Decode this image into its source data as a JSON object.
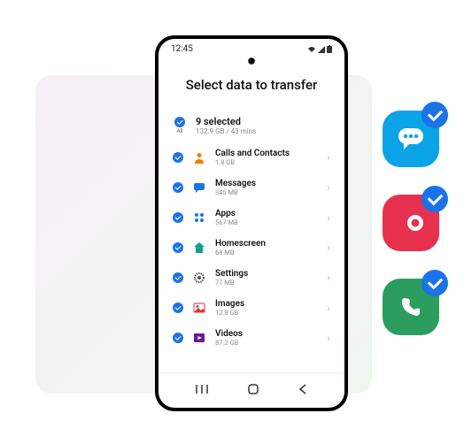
{
  "statusbar": {
    "time": "12:45"
  },
  "page": {
    "title": "Select data to transfer"
  },
  "summary": {
    "title": "9 selected",
    "sub": "132.9 GB / 43 mins",
    "all_label": "All"
  },
  "items": [
    {
      "label": "Calls and Contacts",
      "sub": "1.8 GB"
    },
    {
      "label": "Messages",
      "sub": "345 MB"
    },
    {
      "label": "Apps",
      "sub": "567 MB"
    },
    {
      "label": "Homescreen",
      "sub": "68 MB"
    },
    {
      "label": "Settings",
      "sub": "77 MB"
    },
    {
      "label": "Images",
      "sub": "12.8 GB"
    },
    {
      "label": "Videos",
      "sub": "87.2 GB"
    }
  ]
}
